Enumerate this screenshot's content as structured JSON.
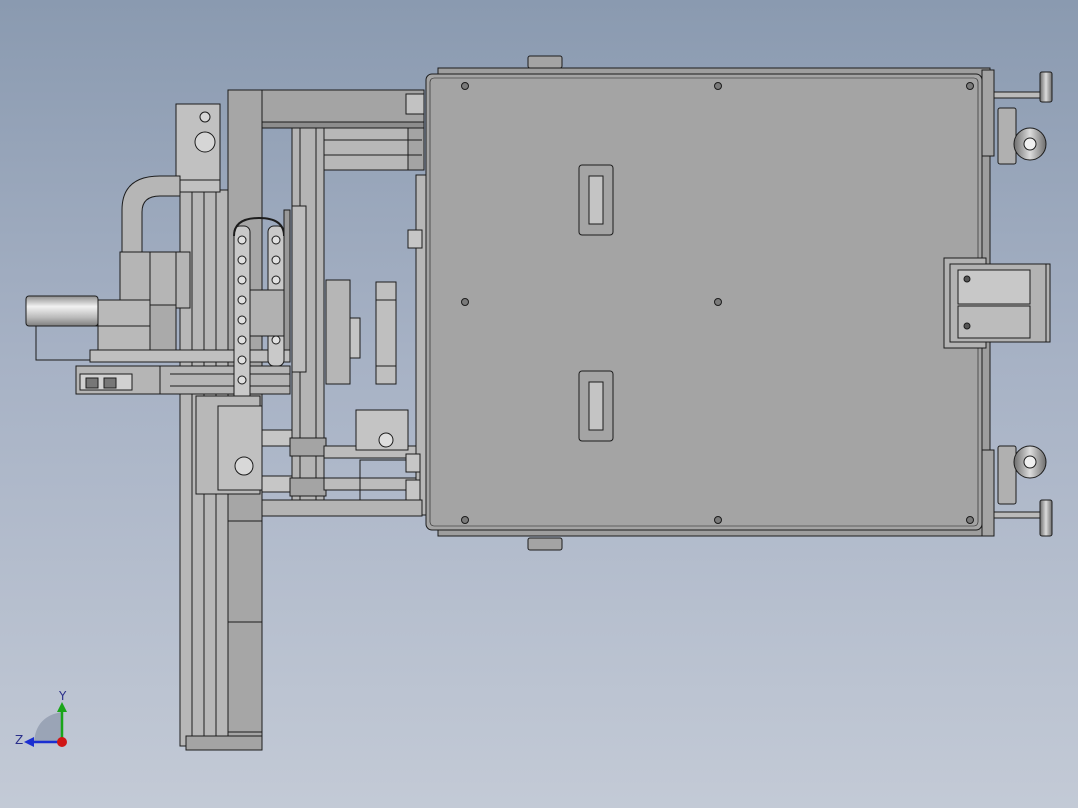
{
  "viewport": {
    "background_top": "#8a9ab0",
    "background_bottom": "#c3cad6"
  },
  "model": {
    "part_fill": "#a4a4a4",
    "part_fill_light": "#b7b7b7",
    "part_fill_dark": "#8d8d8d",
    "edge_color": "#1c1c1c"
  },
  "triad": {
    "y_label": "Y",
    "z_label": "Z",
    "y_color": "#1aa51a",
    "z_color": "#1b2fd1",
    "x_color": "#d01515"
  }
}
